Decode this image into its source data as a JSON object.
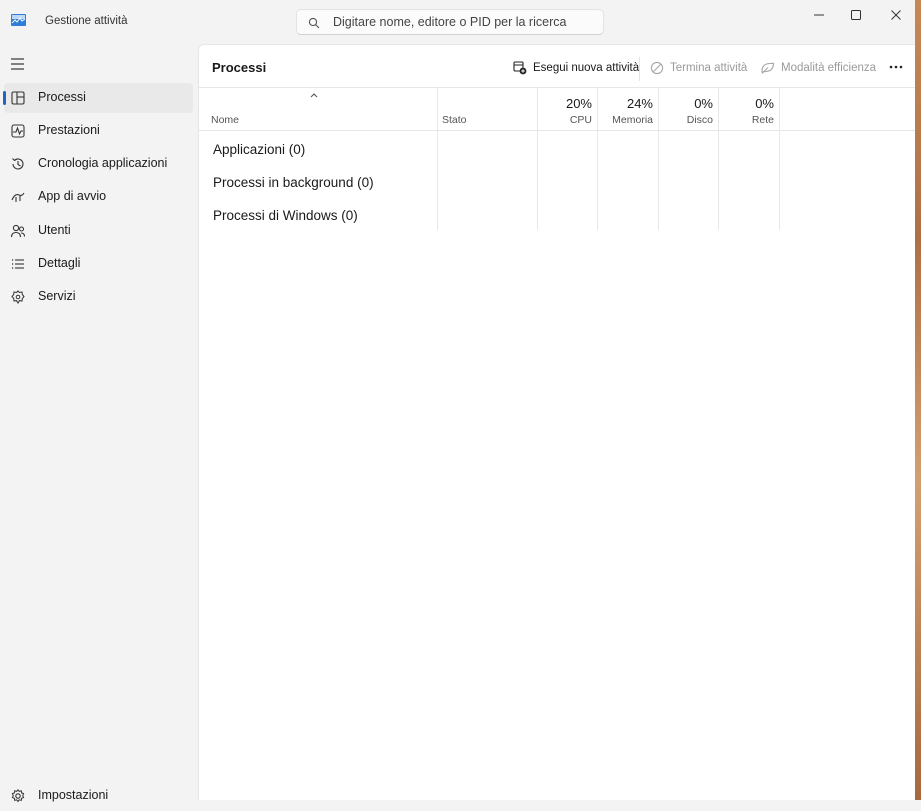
{
  "window": {
    "title": "Gestione attività",
    "search_placeholder": "Digitare nome, editore o PID per la ricerca"
  },
  "sidebar": {
    "items": [
      {
        "label": "Processi",
        "icon": "processes-icon",
        "active": true
      },
      {
        "label": "Prestazioni",
        "icon": "performance-icon",
        "active": false
      },
      {
        "label": "Cronologia applicazioni",
        "icon": "history-icon",
        "active": false
      },
      {
        "label": "App di avvio",
        "icon": "startup-icon",
        "active": false
      },
      {
        "label": "Utenti",
        "icon": "users-icon",
        "active": false
      },
      {
        "label": "Dettagli",
        "icon": "details-icon",
        "active": false
      },
      {
        "label": "Servizi",
        "icon": "services-icon",
        "active": false
      }
    ],
    "settings_label": "Impostazioni"
  },
  "toolbar": {
    "page_title": "Processi",
    "run_new_task": "Esegui nuova attività",
    "end_task": "Termina attività",
    "efficiency_mode": "Modalità efficienza"
  },
  "table": {
    "columns": {
      "name": "Nome",
      "status": "Stato",
      "cpu": {
        "pct": "20%",
        "label": "CPU"
      },
      "memory": {
        "pct": "24%",
        "label": "Memoria"
      },
      "disk": {
        "pct": "0%",
        "label": "Disco"
      },
      "network": {
        "pct": "0%",
        "label": "Rete"
      }
    },
    "groups": [
      {
        "label": "Applicazioni (0)"
      },
      {
        "label": "Processi in background (0)"
      },
      {
        "label": "Processi di Windows (0)"
      }
    ]
  },
  "colors": {
    "accent": "#1f66c1",
    "sidebar_bg": "#f3f3f3",
    "content_bg": "#ffffff"
  }
}
